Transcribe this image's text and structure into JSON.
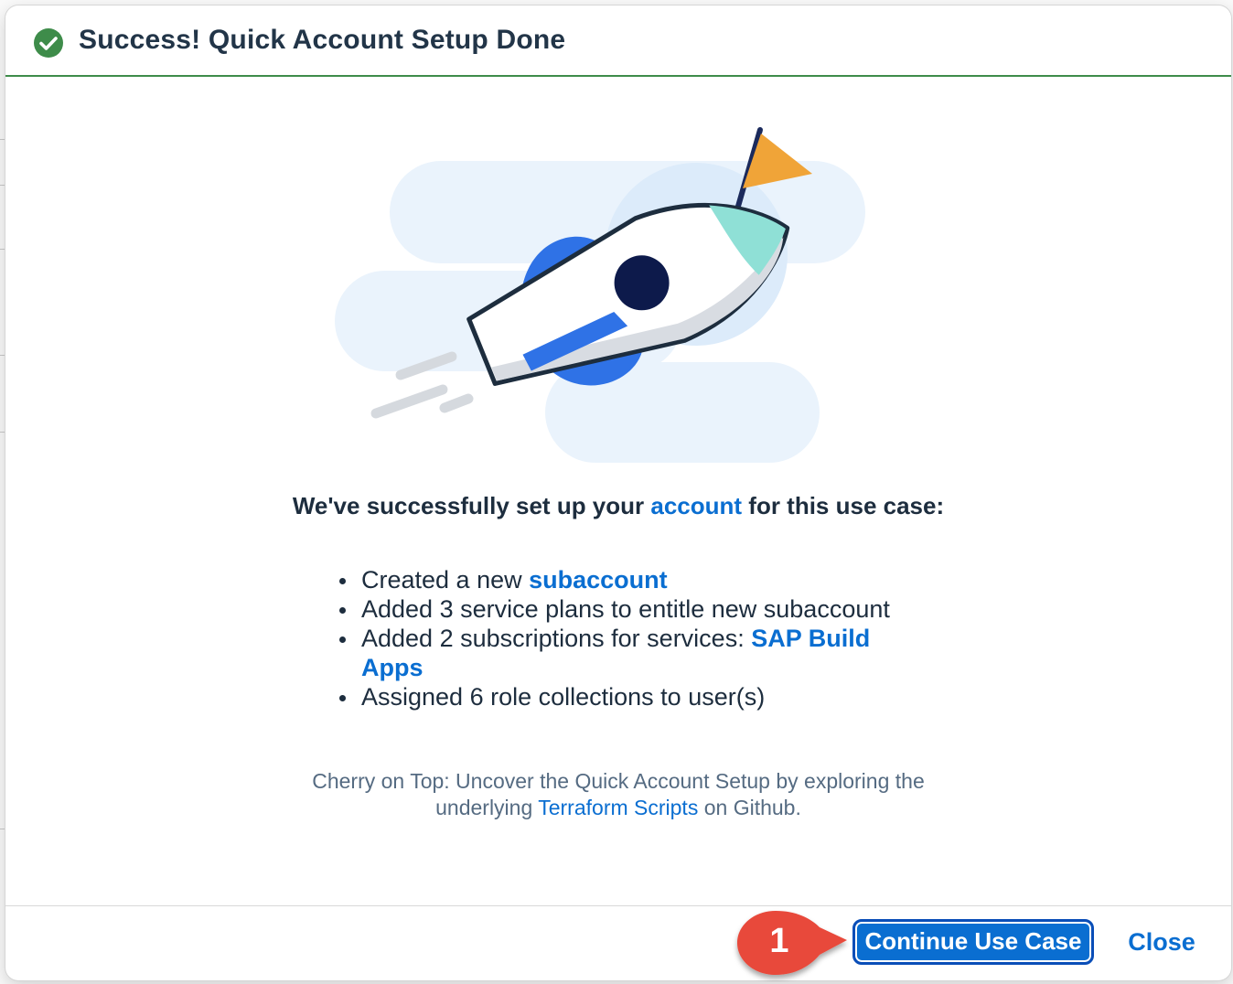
{
  "dialog": {
    "title": "Success! Quick Account Setup Done",
    "icon": "check-circle-icon",
    "accent_color": "#3e8c4a"
  },
  "illustration": {
    "name": "rocket-with-flag-illustration"
  },
  "heading": {
    "prefix": "We've successfully set up your ",
    "link": "account",
    "suffix": " for this use case:"
  },
  "steps": [
    {
      "text": "Created a new ",
      "link": "subaccount"
    },
    {
      "text": "Added 3 service plans to entitle new subaccount",
      "link": ""
    },
    {
      "text": "Added 2 subscriptions for services: ",
      "link": "SAP Build Apps"
    },
    {
      "text": "Assigned 6 role collections to user(s)",
      "link": ""
    }
  ],
  "footnote": {
    "line1": "Cherry on Top: Uncover the Quick Account Setup by exploring the",
    "line2_prefix": "underlying ",
    "link": "Terraform Scripts",
    "line2_suffix": " on Github."
  },
  "footer": {
    "continue_label": "Continue Use Case",
    "close_label": "Close"
  },
  "callout": {
    "number": "1",
    "color": "#e8483a"
  }
}
